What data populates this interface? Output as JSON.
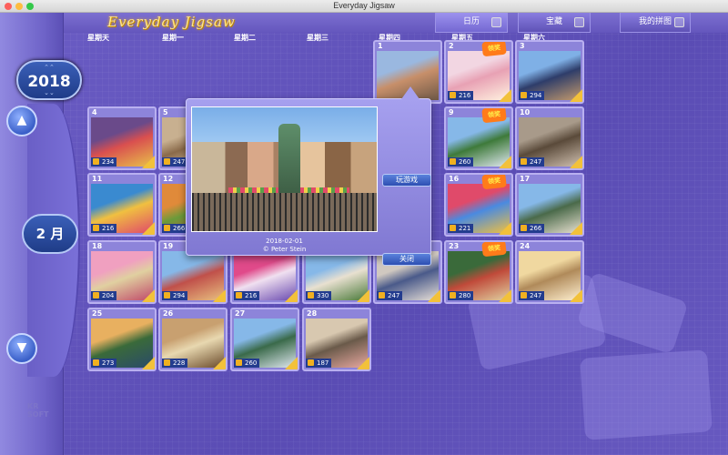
{
  "window": {
    "title": "Everyday Jigsaw"
  },
  "header": {
    "logo": "Everyday Jigsaw",
    "tabs": [
      {
        "label": "日历",
        "icon": "calendar-icon",
        "active": true
      },
      {
        "label": "宝藏",
        "icon": "treasure-icon",
        "active": false
      },
      {
        "label": "我的拼图",
        "icon": "my-puzzles-icon",
        "active": false
      }
    ]
  },
  "weekdays": [
    "星期天",
    "星期一",
    "星期二",
    "星期三",
    "星期四",
    "星期五",
    "星期六"
  ],
  "sidebar": {
    "year": "2018",
    "month": "2 月",
    "brand": "KR\nSOFT"
  },
  "days": [
    {
      "day": "1",
      "count": "",
      "palette": [
        "#9ab8e0",
        "#c78f6a",
        "#6e5846"
      ]
    },
    {
      "day": "2",
      "count": "216",
      "badge": "领奖",
      "palette": [
        "#f2d6e2",
        "#e8a1b4",
        "#fff3e0"
      ]
    },
    {
      "day": "3",
      "count": "294",
      "palette": [
        "#7fb0e6",
        "#2e3d6a",
        "#c49a6c"
      ]
    },
    {
      "day": "4",
      "count": "234",
      "palette": [
        "#6a4a8a",
        "#d94f4f",
        "#e8c04a"
      ]
    },
    {
      "day": "5",
      "count": "247",
      "palette": [
        "#c8b090",
        "#8a6a4a",
        "#f0e0c0"
      ]
    },
    {
      "day": "9",
      "count": "260",
      "badge": "领奖",
      "palette": [
        "#86b8e8",
        "#3e7a3a",
        "#e0e8f0"
      ]
    },
    {
      "day": "10",
      "count": "247",
      "palette": [
        "#a89a8a",
        "#5a4a3a",
        "#d0c0b0"
      ]
    },
    {
      "day": "11",
      "count": "216",
      "palette": [
        "#3a8ad0",
        "#f0c040",
        "#e04a6a"
      ]
    },
    {
      "day": "12",
      "count": "266",
      "palette": [
        "#e08a3a",
        "#6a9a3a",
        "#d04a3a"
      ]
    },
    {
      "day": "16",
      "count": "221",
      "badge": "领奖",
      "palette": [
        "#e04a6a",
        "#4a8ae0",
        "#f0c040"
      ]
    },
    {
      "day": "17",
      "count": "266",
      "palette": [
        "#86b8e8",
        "#4a6a4a",
        "#e8e0d0"
      ]
    },
    {
      "day": "18",
      "count": "204",
      "palette": [
        "#f0a0c0",
        "#e0d0a0",
        "#c04a6a"
      ]
    },
    {
      "day": "19",
      "count": "294",
      "palette": [
        "#86b8e8",
        "#c0504a",
        "#e8c080"
      ]
    },
    {
      "day": "20",
      "count": "216",
      "palette": [
        "#e04a8a",
        "#f0e0f0",
        "#6a4ab0"
      ]
    },
    {
      "day": "21",
      "count": "330",
      "palette": [
        "#86b8e8",
        "#e8e0d0",
        "#4a7a3a"
      ]
    },
    {
      "day": "22",
      "count": "247",
      "palette": [
        "#d0c8c0",
        "#4a5a8a",
        "#e8e0d8"
      ]
    },
    {
      "day": "23",
      "count": "280",
      "badge": "领奖",
      "palette": [
        "#3a6a3a",
        "#c04a3a",
        "#e0d0a0"
      ]
    },
    {
      "day": "24",
      "count": "247",
      "palette": [
        "#f0d8a0",
        "#b08a5a",
        "#fff0d0"
      ]
    },
    {
      "day": "25",
      "count": "273",
      "palette": [
        "#e8b060",
        "#3a6a3a",
        "#2a4a6a"
      ]
    },
    {
      "day": "26",
      "count": "228",
      "palette": [
        "#c8a070",
        "#e8d8b0",
        "#6a4a2a"
      ]
    },
    {
      "day": "27",
      "count": "260",
      "palette": [
        "#86b8e8",
        "#3a6a4a",
        "#e0e8f0"
      ]
    },
    {
      "day": "28",
      "count": "187",
      "palette": [
        "#d8c8b0",
        "#6a5a4a",
        "#e8a8a0"
      ]
    }
  ],
  "popup": {
    "date": "2018-02-01",
    "credit": "© Peter Stein",
    "play_label": "玩游戏",
    "close_label": "关闭"
  }
}
